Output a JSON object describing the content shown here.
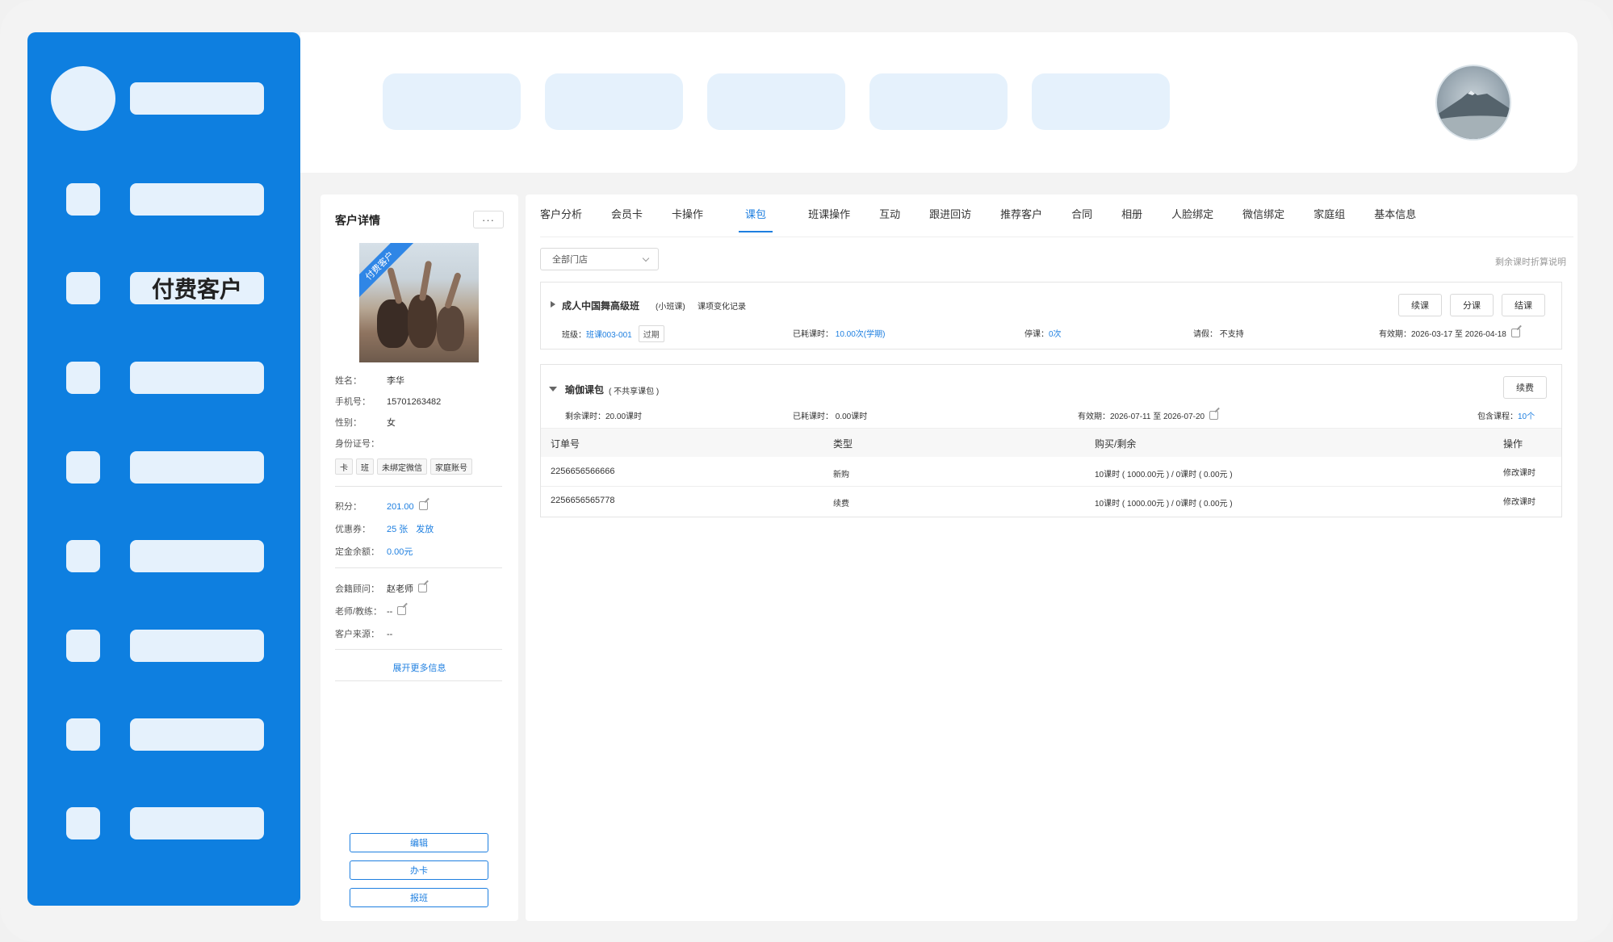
{
  "sidebar": {
    "active_label": "付费客户"
  },
  "customer": {
    "title": "客户详情",
    "more": "···",
    "photo_tag": "付费客户",
    "fields": [
      {
        "label": "姓名：",
        "value": "李华"
      },
      {
        "label": "手机号：",
        "value": "15701263482"
      },
      {
        "label": "性别：",
        "value": "女"
      },
      {
        "label": "身份证号：",
        "value": ""
      }
    ],
    "tags": [
      "卡",
      "班",
      "未绑定微信",
      "家庭账号"
    ],
    "points_label": "积分：",
    "points_value": "201.00",
    "coupon_label": "优惠券：",
    "coupon_value": "25 张",
    "coupon_action": "发放",
    "deposit_label": "定金余额：",
    "deposit_value": "0.00元",
    "advisor_label": "会籍顾问：",
    "advisor_value": "赵老师",
    "coach_label": "老师/教练：",
    "coach_value": "--",
    "source_label": "客户来源：",
    "source_value": "--",
    "expand": "展开更多信息",
    "buttons": {
      "edit": "编辑",
      "card": "办卡",
      "class": "报班"
    }
  },
  "tabs": [
    "客户分析",
    "会员卡",
    "卡操作",
    "课包",
    "班课操作",
    "互动",
    "跟进回访",
    "推荐客户",
    "合同",
    "相册",
    "人脸绑定",
    "微信绑定",
    "家庭组",
    "基本信息"
  ],
  "active_tab": "课包",
  "filter": {
    "store": "全部门店",
    "note": "剩余课时折算说明"
  },
  "class_pkg": {
    "name": "成人中国舞高级班",
    "type": "(小班课)",
    "record_link": "课项变化记录",
    "buttons": [
      "续课",
      "分课",
      "结课"
    ],
    "class_label": "班级：",
    "class_value": "班课003-001",
    "class_status": "过期",
    "used_label": "已耗课时：",
    "used_value": "10.00次(学期)",
    "stop_label": "停课：",
    "stop_value": "0次",
    "leave_label": "请假：",
    "leave_value": "不支持",
    "valid_label": "有效期：",
    "valid_value": "2026-03-17 至 2026-04-18"
  },
  "course_pkg": {
    "name": "瑜伽课包",
    "note": "( 不共享课包 )",
    "renew": "续费",
    "remain": "剩余课时：20.00课时",
    "used": "已耗课时：  0.00课时",
    "valid": "有效期：2026-07-11 至 2026-07-20",
    "include_label": "包含课程：",
    "include_value": "10个",
    "columns": [
      "订单号",
      "类型",
      "购买/剩余",
      "操作"
    ],
    "rows": [
      {
        "order": "2256656566666",
        "type": "新购",
        "amount": "10课时 ( 1000.00元 ) / 0课时 ( 0.00元 )",
        "action": "修改课时"
      },
      {
        "order": "2256656565778",
        "type": "续费",
        "amount": "10课时 ( 1000.00元 ) / 0课时 ( 0.00元 )",
        "action": "修改课时"
      }
    ]
  },
  "colors": {
    "brand": "#0e7fe0",
    "accent": "#1e7fe0",
    "pill": "#e5f1fc"
  }
}
